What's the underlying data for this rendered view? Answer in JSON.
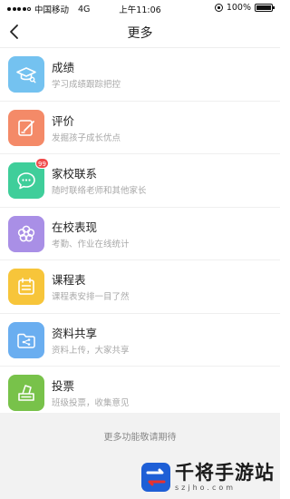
{
  "status_bar": {
    "carrier": "中国移动",
    "network": "4G",
    "time": "上午11:06",
    "battery": "100%",
    "battery_level": 1.0
  },
  "nav": {
    "title": "更多",
    "back_icon": "chevron-left-icon"
  },
  "items": [
    {
      "title": "成绩",
      "subtitle": "学习成绩跟踪把控",
      "icon": "graduation-cap-icon",
      "color": "#74c2f0",
      "badge": ""
    },
    {
      "title": "评价",
      "subtitle": "发掘孩子成长优点",
      "icon": "edit-icon",
      "color": "#f48a68",
      "badge": ""
    },
    {
      "title": "家校联系",
      "subtitle": "随时联络老师和其他家长",
      "icon": "chat-icon",
      "color": "#3fce9a",
      "badge": "99"
    },
    {
      "title": "在校表现",
      "subtitle": "考勤、作业在线统计",
      "icon": "flower-icon",
      "color": "#a98fe6",
      "badge": ""
    },
    {
      "title": "课程表",
      "subtitle": "课程表安排一目了然",
      "icon": "calendar-icon",
      "color": "#f7c53a",
      "badge": ""
    },
    {
      "title": "资料共享",
      "subtitle": "资料上传，大家共享",
      "icon": "share-folder-icon",
      "color": "#6aaef0",
      "badge": ""
    },
    {
      "title": "投票",
      "subtitle": "班级投票，收集意见",
      "icon": "vote-box-icon",
      "color": "#78c24a",
      "badge": ""
    }
  ],
  "footer": {
    "note": "更多功能敬请期待"
  },
  "watermark": {
    "title": "千将手游站",
    "url": "szjho.com"
  }
}
